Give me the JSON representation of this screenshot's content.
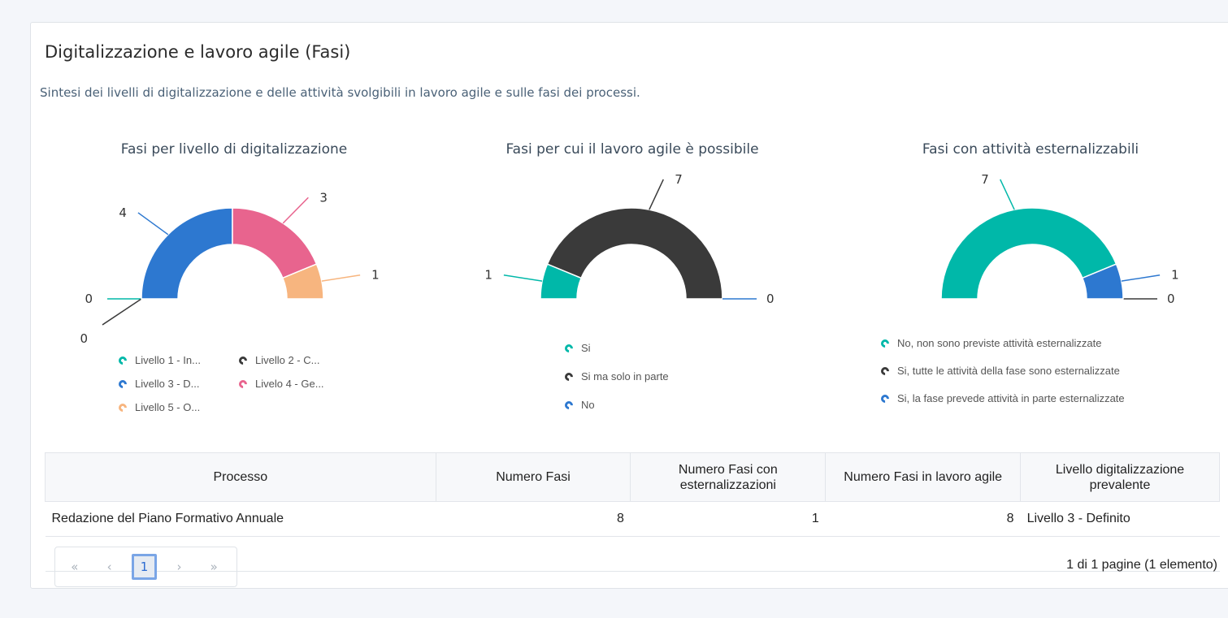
{
  "card": {
    "title": "Digitalizzazione e lavoro agile (Fasi)",
    "subtitle": "Sintesi dei livelli di digitalizzazione e delle attività svolgibili in lavoro agile e sulle fasi dei processi."
  },
  "chart_data": [
    {
      "type": "pie",
      "style": "semi-donut",
      "title": "Fasi per livello di digitalizzazione",
      "categories": [
        "Livello 1 - In...",
        "Livello 2 - C...",
        "Livello 3 - D...",
        "Livelo 4 - Ge...",
        "Livello 5 - O..."
      ],
      "values": [
        0,
        0,
        4,
        3,
        1
      ],
      "colors": [
        "#00b8a9",
        "#3a3a3a",
        "#2d78d0",
        "#e8648e",
        "#f7b57f"
      ]
    },
    {
      "type": "pie",
      "style": "semi-donut",
      "title": "Fasi per cui il lavoro agile è possibile",
      "categories": [
        "Si",
        "Si ma solo in parte",
        "No"
      ],
      "values": [
        1,
        7,
        0
      ],
      "colors": [
        "#00b8a9",
        "#3a3a3a",
        "#2d78d0"
      ]
    },
    {
      "type": "pie",
      "style": "semi-donut",
      "title": "Fasi con attività esternalizzabili",
      "categories": [
        "No, non sono previste attività esternalizzate",
        "Si, tutte le attività della fase sono esternalizzate",
        "Si, la fase prevede attività in parte esternalizzate"
      ],
      "values": [
        7,
        0,
        1
      ],
      "colors": [
        "#00b8a9",
        "#3a3a3a",
        "#2d78d0"
      ]
    }
  ],
  "table": {
    "headers": [
      "Processo",
      "Numero Fasi",
      "Numero Fasi con esternalizzazioni",
      "Numero Fasi in lavoro agile",
      "Livello digitalizzazione prevalente"
    ],
    "rows": [
      [
        "Redazione del Piano Formativo Annuale",
        "8",
        "1",
        "8",
        "Livello 3 - Definito"
      ]
    ]
  },
  "pager": {
    "first": "«",
    "prev": "‹",
    "current": "1",
    "next": "›",
    "last": "»",
    "info": "1 di 1 pagine (1 elemento)"
  }
}
